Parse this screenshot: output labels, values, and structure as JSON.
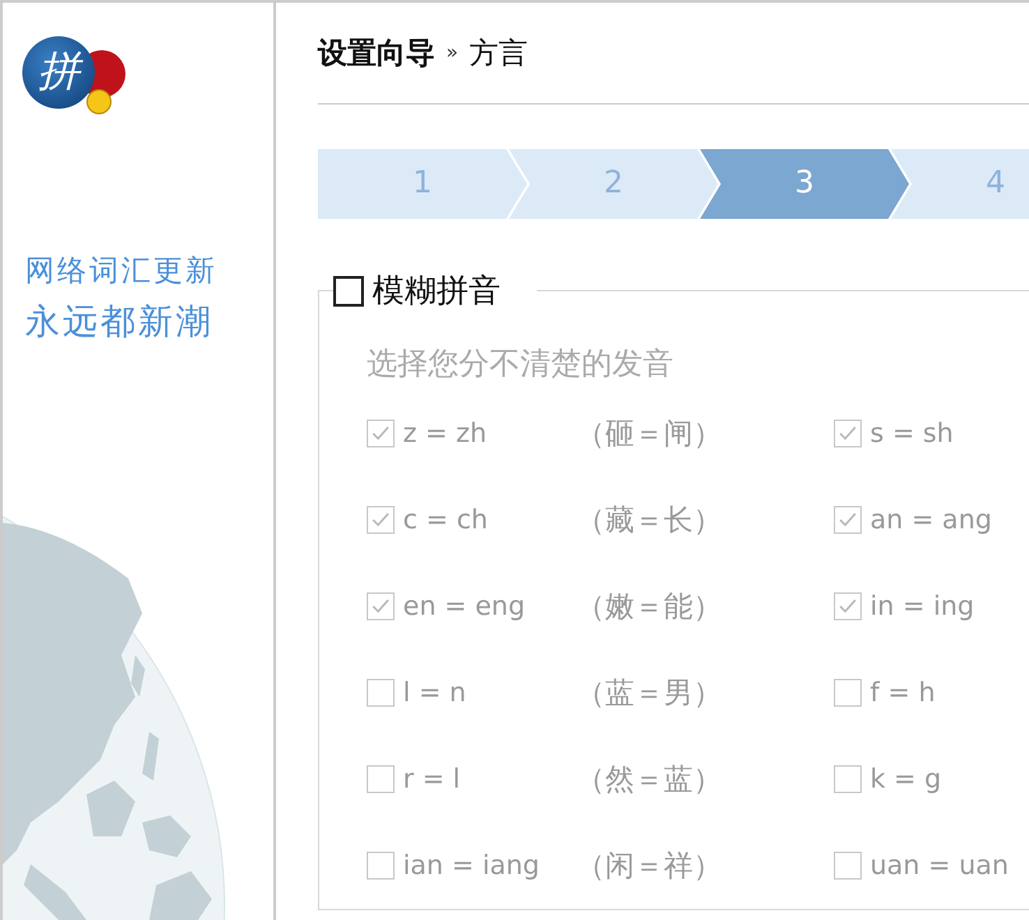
{
  "sidebar": {
    "logo_glyph": "拼",
    "slogan": [
      "网络词汇更新",
      "永远都新潮"
    ]
  },
  "header": {
    "title": "设置向导",
    "separator": "»",
    "section": "方言"
  },
  "steps": [
    {
      "label": "1",
      "selected": false
    },
    {
      "label": "2",
      "selected": false
    },
    {
      "label": "3",
      "selected": true
    },
    {
      "label": "4",
      "selected": false
    }
  ],
  "fuzzy": {
    "label": "模糊拼音",
    "checked": false,
    "hint": "选择您分不清楚的发音",
    "rows": [
      {
        "left": {
          "label": "z = zh",
          "checked": true
        },
        "example": "（砸＝闸）",
        "right": {
          "label": "s = sh",
          "checked": true
        }
      },
      {
        "left": {
          "label": "c = ch",
          "checked": true
        },
        "example": "（藏＝长）",
        "right": {
          "label": "an = ang",
          "checked": true
        }
      },
      {
        "left": {
          "label": "en = eng",
          "checked": true
        },
        "example": "（嫩＝能）",
        "right": {
          "label": "in = ing",
          "checked": true
        }
      },
      {
        "left": {
          "label": "l = n",
          "checked": false
        },
        "example": "（蓝＝男）",
        "right": {
          "label": "f = h",
          "checked": false
        }
      },
      {
        "left": {
          "label": "r = l",
          "checked": false
        },
        "example": "（然＝蓝）",
        "right": {
          "label": "k = g",
          "checked": false
        }
      },
      {
        "left": {
          "label": "ian = iang",
          "checked": false
        },
        "example": "（闲＝祥）",
        "right": {
          "label": "uan = uan",
          "checked": false
        }
      }
    ]
  }
}
